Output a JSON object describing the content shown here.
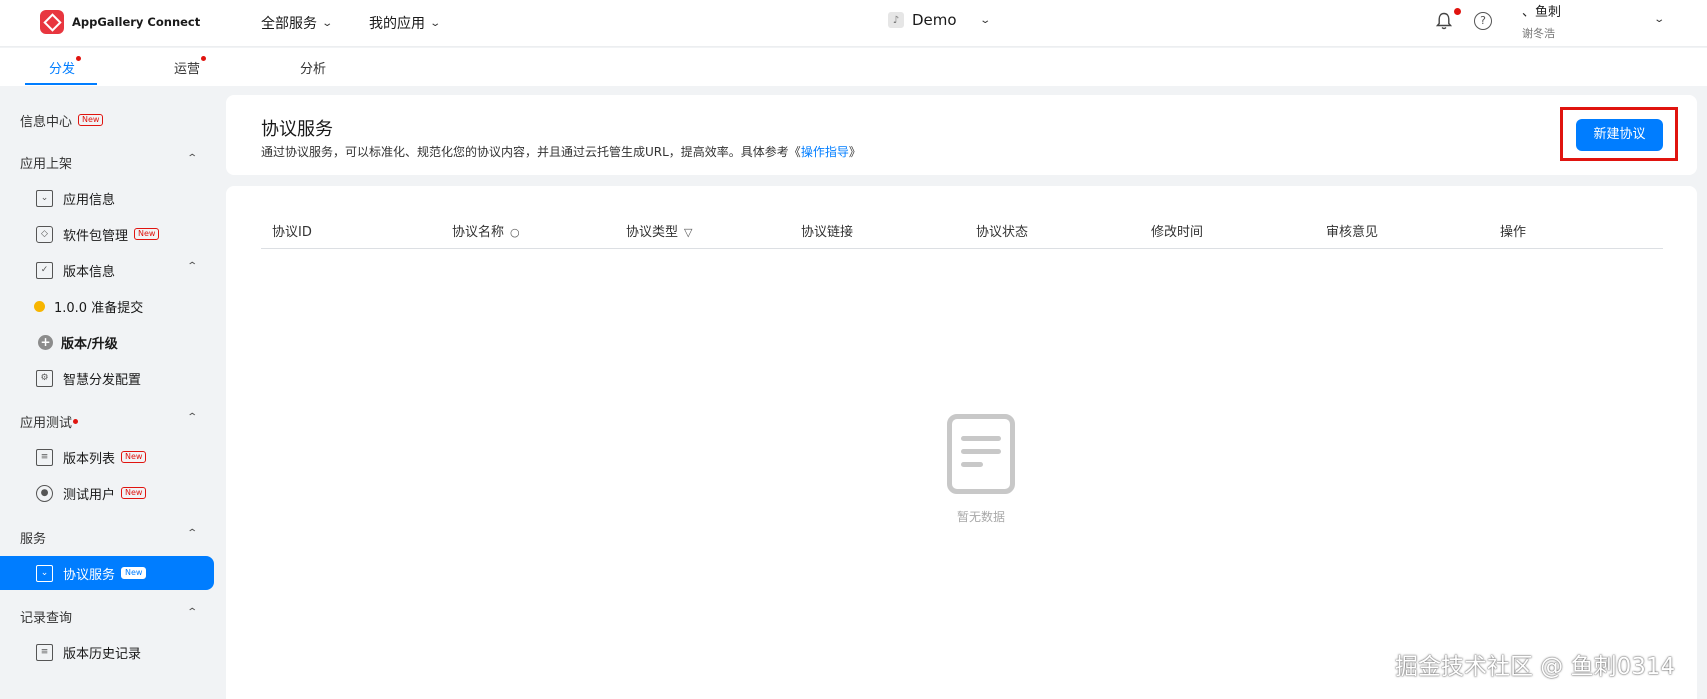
{
  "header": {
    "brand": "AppGallery Connect",
    "nav": [
      "全部服务",
      "我的应用"
    ],
    "app_name": "Demo",
    "user_name": "、鱼刺",
    "user_sub": "谢冬浩"
  },
  "tabs": [
    {
      "label": "分发",
      "active": true,
      "dot": true
    },
    {
      "label": "运营",
      "active": false,
      "dot": true
    },
    {
      "label": "分析",
      "active": false,
      "dot": false
    }
  ],
  "sidebar": {
    "info_center": "信息中心",
    "new_tag": "New",
    "group_listing": "应用上架",
    "app_info": "应用信息",
    "package_mgmt": "软件包管理",
    "version_info": "版本信息",
    "version_entry": "1.0.0 准备提交",
    "version_upgrade": "版本/升级",
    "smart_dist": "智慧分发配置",
    "group_testing": "应用测试",
    "version_list": "版本列表",
    "test_users": "测试用户",
    "group_services": "服务",
    "agreement_service": "协议服务",
    "group_records": "记录查询",
    "version_history": "版本历史记录"
  },
  "main": {
    "title": "协议服务",
    "desc_prefix": "通过协议服务，可以标准化、规范化您的协议内容，并且通过云托管生成URL，提高效率。具体参考《",
    "desc_link": "操作指导",
    "desc_suffix": "》",
    "new_button": "新建协议",
    "columns": [
      "协议ID",
      "协议名称",
      "协议类型",
      "协议链接",
      "协议状态",
      "修改时间",
      "审核意见",
      "操作"
    ],
    "empty_text": "暂无数据"
  },
  "watermark": "掘金技术社区 @ 鱼刺0314",
  "colors": {
    "accent": "#007dff",
    "alert": "#e0140f",
    "pending": "#f7b500"
  }
}
